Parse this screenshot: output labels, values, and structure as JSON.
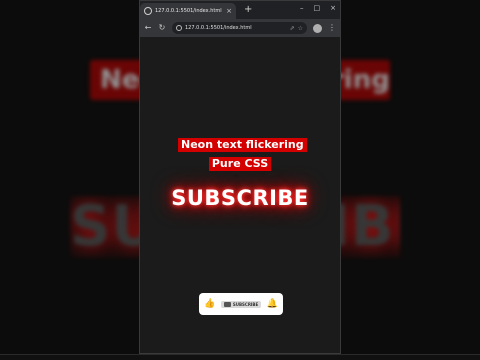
{
  "browser": {
    "tab_title": "127.0.0.1:5501/index.html",
    "tab_close": "×",
    "new_tab": "+",
    "url": "127.0.0.1:5501/index.html",
    "win_min": "–",
    "win_max": "□",
    "win_close": "×"
  },
  "page": {
    "heading_line1": "Neon text flickering",
    "heading_line2": "Pure CSS",
    "neon_text": "SUBSCRIBE",
    "subscribe_pill": "SUBSCRIBE"
  },
  "background": {
    "heading_text": "Neon text flickering",
    "subscribe_text": "SUBSCRIBE"
  },
  "colors": {
    "accent_red": "#d40000",
    "neon_glow": "#ff1a1a",
    "icon_blue": "#2f7be0"
  },
  "icons": {
    "like": "thumbs-up-icon",
    "bell": "bell-icon",
    "youtube": "youtube-icon"
  }
}
